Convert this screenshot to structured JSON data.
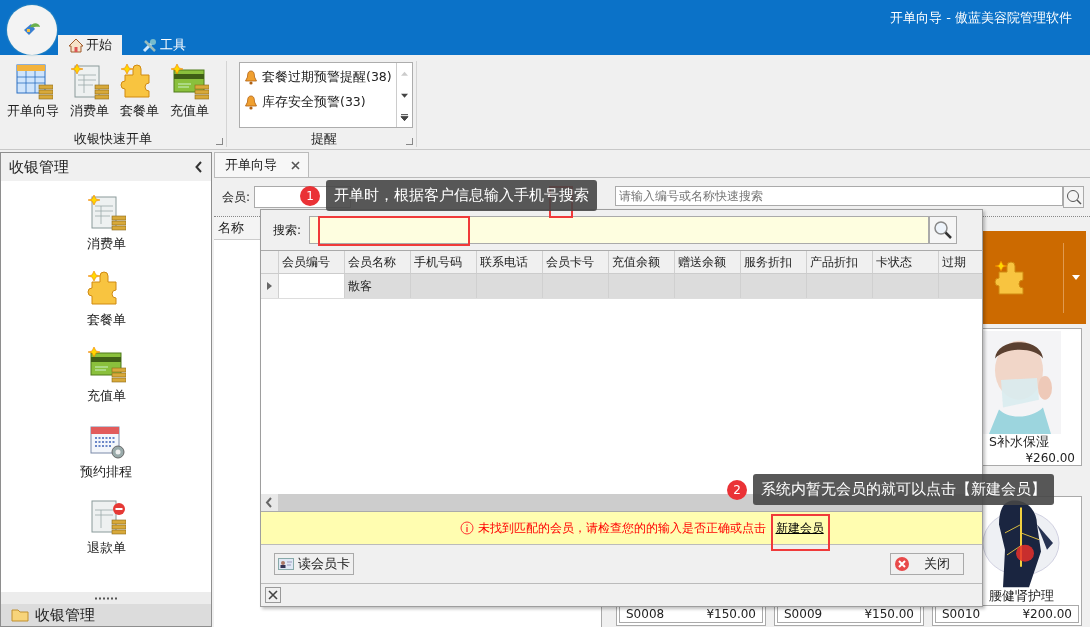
{
  "window": {
    "title": "开单向导 - 傲蓝美容院管理软件"
  },
  "ribbon_tabs": [
    {
      "label": "开始",
      "kind": "home",
      "selected": true
    },
    {
      "label": "工具",
      "kind": "tools",
      "selected": false
    }
  ],
  "quick_group": {
    "label": "收银快速开单",
    "buttons": [
      {
        "label": "开单向导",
        "kind": "wizard"
      },
      {
        "label": "消费单",
        "kind": "consume"
      },
      {
        "label": "套餐单",
        "kind": "package"
      },
      {
        "label": "充值单",
        "kind": "recharge"
      }
    ]
  },
  "alert_group": {
    "label": "提醒",
    "items": [
      {
        "label": "套餐过期预警提醒(38)"
      },
      {
        "label": "库存安全预警(33)"
      }
    ]
  },
  "sidebar": {
    "title": "收银管理",
    "items": [
      {
        "label": "消费单",
        "kind": "consume"
      },
      {
        "label": "套餐单",
        "kind": "package"
      },
      {
        "label": "充值单",
        "kind": "recharge"
      },
      {
        "label": "预约排程",
        "kind": "schedule"
      },
      {
        "label": "退款单",
        "kind": "refund"
      }
    ],
    "footer": "收银管理"
  },
  "document_tabs": [
    {
      "label": "开单向导",
      "selected": true
    }
  ],
  "member_label": "会员:",
  "quick_search": {
    "placeholder": "请输入编号或名称快速搜索"
  },
  "list_header": "名称",
  "products": [
    {
      "name": "S补水保湿",
      "price": "¥260.00",
      "kind": "face"
    },
    {
      "code": "S0008",
      "price": "¥150.00"
    },
    {
      "code": "S0009",
      "price": "¥150.00"
    },
    {
      "name": "腰健肾护理",
      "code": "S0010",
      "price": "¥200.00",
      "kind": "back"
    }
  ],
  "popup": {
    "search_label": "搜索:",
    "columns": [
      "会员编号",
      "会员名称",
      "手机号码",
      "联系电话",
      "会员卡号",
      "充值余额",
      "赠送余额",
      "服务折扣",
      "产品折扣",
      "卡状态",
      "过期"
    ],
    "rows": [
      {
        "cells": [
          "",
          "散客",
          "",
          "",
          "",
          "",
          "",
          "",
          "",
          "",
          ""
        ],
        "selected": true
      }
    ],
    "message": "未找到匹配的会员，请检查您的的输入是否正确或点击",
    "link": "新建会员",
    "buttons": [
      {
        "label": "读会员卡",
        "kind": "card"
      },
      {
        "label": "关闭",
        "kind": "close"
      }
    ]
  },
  "callouts": [
    {
      "number": "1",
      "text": "开单时，根据客户信息输入手机号搜索"
    },
    {
      "number": "2",
      "text": "系统内暂无会员的就可以点击【新建会员】"
    }
  ]
}
